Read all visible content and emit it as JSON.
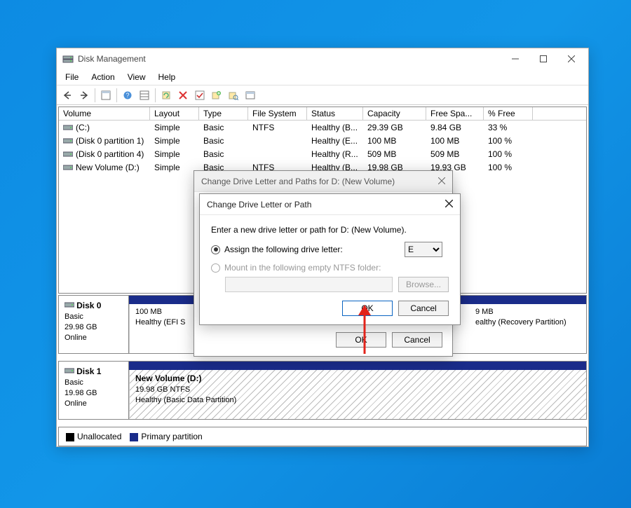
{
  "window": {
    "title": "Disk Management",
    "menus": [
      "File",
      "Action",
      "View",
      "Help"
    ]
  },
  "columns": {
    "volume": "Volume",
    "layout": "Layout",
    "type": "Type",
    "filesystem": "File System",
    "status": "Status",
    "capacity": "Capacity",
    "free": "Free Spa...",
    "pct": "% Free"
  },
  "rows": [
    {
      "volume": "(C:)",
      "layout": "Simple",
      "type": "Basic",
      "fs": "NTFS",
      "status": "Healthy (B...",
      "cap": "29.39 GB",
      "free": "9.84 GB",
      "pct": "33 %"
    },
    {
      "volume": "(Disk 0 partition 1)",
      "layout": "Simple",
      "type": "Basic",
      "fs": "",
      "status": "Healthy (E...",
      "cap": "100 MB",
      "free": "100 MB",
      "pct": "100 %"
    },
    {
      "volume": "(Disk 0 partition 4)",
      "layout": "Simple",
      "type": "Basic",
      "fs": "",
      "status": "Healthy (R...",
      "cap": "509 MB",
      "free": "509 MB",
      "pct": "100 %"
    },
    {
      "volume": "New Volume (D:)",
      "layout": "Simple",
      "type": "Basic",
      "fs": "NTFS",
      "status": "Healthy (B...",
      "cap": "19.98 GB",
      "free": "19.93 GB",
      "pct": "100 %"
    }
  ],
  "disk0": {
    "name": "Disk 0",
    "type": "Basic",
    "size": "29.98 GB",
    "state": "Online",
    "part_left_size": "100 MB",
    "part_left_health": "Healthy (EFI S",
    "part_right_size": "9 MB",
    "part_right_health": "ealthy (Recovery Partition)"
  },
  "disk1": {
    "name": "Disk 1",
    "type": "Basic",
    "size": "19.98 GB",
    "state": "Online",
    "vol_name": "New Volume  (D:)",
    "vol_size": "19.98 GB NTFS",
    "vol_health": "Healthy (Basic Data Partition)"
  },
  "legend": {
    "unallocated": "Unallocated",
    "primary": "Primary partition"
  },
  "dlg_outer": {
    "title": "Change Drive Letter and Paths for D: (New Volume)",
    "ok": "OK",
    "cancel": "Cancel"
  },
  "dlg_inner": {
    "title": "Change Drive Letter or Path",
    "intro": "Enter a new drive letter or path for D: (New Volume).",
    "opt_assign": "Assign the following drive letter:",
    "opt_mount": "Mount in the following empty NTFS folder:",
    "browse": "Browse...",
    "letter": "E",
    "ok": "OK",
    "cancel": "Cancel"
  }
}
